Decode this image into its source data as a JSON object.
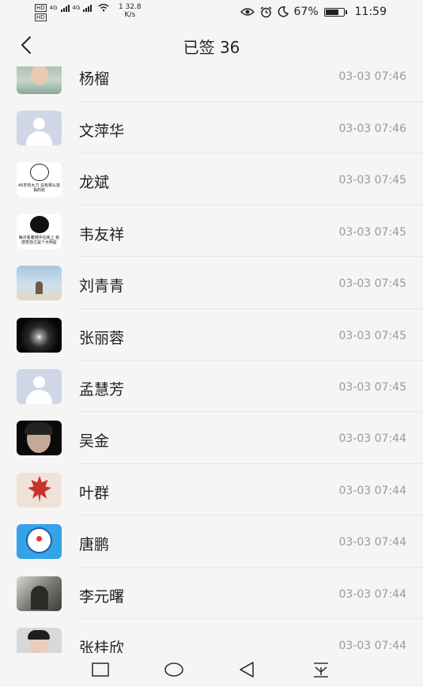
{
  "status_bar": {
    "network_left_top": "4G",
    "network_left_bottom": "4G",
    "speed_value": "32.8",
    "speed_unit": "K/s",
    "speed_prefix": "1",
    "battery_percent": "67%",
    "battery_level": 0.67,
    "time": "11:59",
    "icons": [
      "hd-icon",
      "signal-icon",
      "wifi-icon",
      "eye-icon",
      "alarm-icon",
      "moon-icon",
      "battery-icon"
    ]
  },
  "header": {
    "title": "已签 36",
    "back_icon": "chevron-left-icon"
  },
  "list": [
    {
      "name": "杨榴",
      "time": "03-03 07:46",
      "avatar": "photo"
    },
    {
      "name": "文萍华",
      "time": "03-03 07:46",
      "avatar": "placeholder"
    },
    {
      "name": "龙斌",
      "time": "03-03 07:45",
      "avatar": "meme",
      "avatar_text": "40岁的大刀 没有那么容易的收"
    },
    {
      "name": "韦友祥",
      "time": "03-03 07:45",
      "avatar": "meme",
      "avatar_text": "每次看着镜中在街上 就感觉自己是个大明星"
    },
    {
      "name": "刘青青",
      "time": "03-03 07:45",
      "avatar": "photo"
    },
    {
      "name": "张丽蓉",
      "time": "03-03 07:45",
      "avatar": "photo"
    },
    {
      "name": "孟慧芳",
      "time": "03-03 07:45",
      "avatar": "placeholder"
    },
    {
      "name": "吴金",
      "time": "03-03 07:44",
      "avatar": "photo"
    },
    {
      "name": "叶群",
      "time": "03-03 07:44",
      "avatar": "photo"
    },
    {
      "name": "唐鹏",
      "time": "03-03 07:44",
      "avatar": "photo"
    },
    {
      "name": "李元曙",
      "time": "03-03 07:44",
      "avatar": "photo"
    },
    {
      "name": "张桂欣",
      "time": "03-03 07:44",
      "avatar": "photo"
    }
  ],
  "nav_bar": {
    "buttons": [
      "square-icon",
      "circle-icon",
      "triangle-back-icon",
      "notification-down-icon"
    ]
  }
}
